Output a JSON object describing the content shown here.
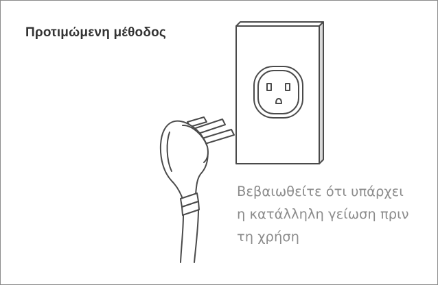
{
  "heading": "Προτιμώμενη μέθοδος",
  "caption": {
    "lines": [
      "Βεβαιωθείτε ότι υπάρχει",
      "η κατάλληλη γείωση πριν",
      "τη χρήση"
    ]
  }
}
